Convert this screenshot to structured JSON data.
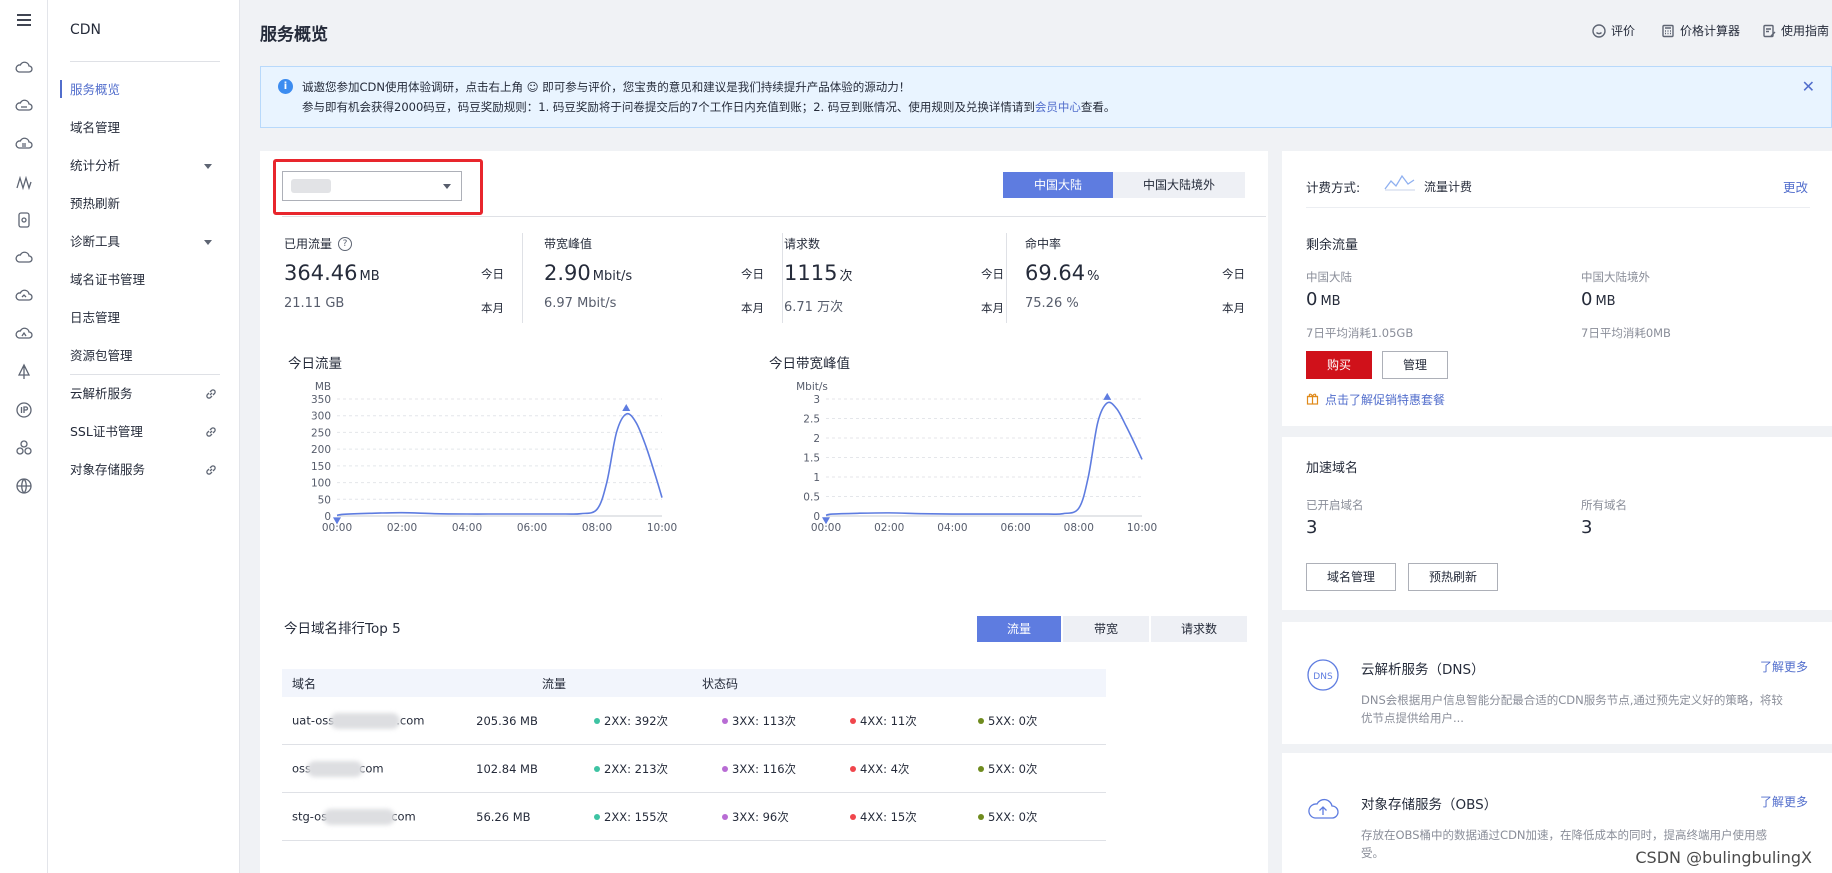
{
  "nav": {
    "title": "CDN",
    "items": [
      {
        "label": "服务概览"
      },
      {
        "label": "域名管理"
      },
      {
        "label": "统计分析"
      },
      {
        "label": "预热刷新"
      },
      {
        "label": "诊断工具"
      },
      {
        "label": "域名证书管理"
      },
      {
        "label": "日志管理"
      },
      {
        "label": "资源包管理"
      },
      {
        "label": "云解析服务"
      },
      {
        "label": "SSL证书管理"
      },
      {
        "label": "对象存储服务"
      }
    ]
  },
  "header": {
    "title": "服务概览",
    "links": [
      "评价",
      "价格计算器",
      "使用指南"
    ]
  },
  "notice": {
    "line1": "诚邀您参加CDN使用体验调研，点击右上角 ☺ 即可参与评价，您宝贵的意见和建议是我们持续提升产品体验的源动力！",
    "line2_prefix": "参与即有机会获得2000码豆，码豆奖励规则：1. 码豆奖励将于问卷提交后的7个工作日内充值到账；2. 码豆到账情况、使用规则及兑换详情请到",
    "line2_link": "会员中心",
    "line2_suffix": "查看。"
  },
  "region_tabs": [
    "中国大陆",
    "中国大陆境外"
  ],
  "metrics": [
    {
      "title": "已用流量",
      "value": "364.46",
      "unit": "MB",
      "today": "今日",
      "month_value": "21.11 GB",
      "month": "本月"
    },
    {
      "title": "带宽峰值",
      "value": "2.90",
      "unit": "Mbit/s",
      "today": "今日",
      "month_value": "6.97 Mbit/s",
      "month": "本月"
    },
    {
      "title": "请求数",
      "value": "1115",
      "unit": "次",
      "today": "今日",
      "month_value": "6.71 万次",
      "month": "本月"
    },
    {
      "title": "命中率",
      "value": "69.64",
      "unit": "%",
      "today": "今日",
      "month_value": "75.26 %",
      "month": "本月"
    }
  ],
  "chart_data": [
    {
      "type": "line",
      "title": "今日流量",
      "ylabel": "MB",
      "yticks": [
        0,
        50,
        100,
        150,
        200,
        250,
        300,
        350
      ],
      "ylim": [
        0,
        350
      ],
      "xticks": [
        "00:00",
        "02:00",
        "04:00",
        "06:00",
        "08:00",
        "10:00"
      ],
      "xlim": [
        0,
        10
      ],
      "x": [
        0,
        0.2,
        1,
        2,
        3,
        4,
        5,
        6,
        7,
        7.5,
        8,
        8.3,
        8.6,
        8.9,
        9.2,
        9.5,
        9.8,
        10.0
      ],
      "y": [
        2,
        5,
        8,
        10,
        7,
        6,
        6,
        6,
        6,
        7,
        20,
        100,
        250,
        305,
        280,
        210,
        120,
        55
      ],
      "color": "#5e7ce0"
    },
    {
      "type": "line",
      "title": "今日带宽峰值",
      "ylabel": "Mbit/s",
      "yticks": [
        0,
        0.5,
        1,
        1.5,
        2,
        2.5,
        3
      ],
      "ylim": [
        0,
        3
      ],
      "xticks": [
        "00:00",
        "02:00",
        "04:00",
        "06:00",
        "08:00",
        "10:00"
      ],
      "xlim": [
        0,
        10
      ],
      "x": [
        0,
        0.2,
        1,
        2,
        3,
        4,
        5,
        6,
        7,
        7.5,
        8,
        8.3,
        8.6,
        8.9,
        9.2,
        9.5,
        9.8,
        10.0
      ],
      "y": [
        0.02,
        0.05,
        0.07,
        0.08,
        0.06,
        0.05,
        0.05,
        0.05,
        0.05,
        0.06,
        0.2,
        1.0,
        2.4,
        2.9,
        2.75,
        2.3,
        1.8,
        1.45
      ],
      "color": "#5e7ce0"
    }
  ],
  "top5": {
    "title": "今日域名排行Top 5",
    "tabs": [
      "流量",
      "带宽",
      "请求数"
    ],
    "headers": [
      "域名",
      "流量",
      "状态码"
    ],
    "rows": [
      {
        "domain_prefix": "uat-oss",
        "domain_suffix": ".com",
        "traffic": "205.36 MB",
        "s2": "2XX: 392次",
        "s3": "3XX: 113次",
        "s4": "4XX: 11次",
        "s5": "5XX: 0次"
      },
      {
        "domain_prefix": "oss",
        "domain_suffix": "com",
        "traffic": "102.84 MB",
        "s2": "2XX: 213次",
        "s3": "3XX: 116次",
        "s4": "4XX: 4次",
        "s5": "5XX: 0次"
      },
      {
        "domain_prefix": "stg-os",
        "domain_suffix": "com",
        "traffic": "56.26 MB",
        "s2": "2XX: 155次",
        "s3": "3XX: 96次",
        "s4": "4XX: 15次",
        "s5": "5XX: 0次"
      }
    ],
    "status_colors": {
      "s2": "#3ec3a3",
      "s3": "#b86cd4",
      "s4": "#f0464c",
      "s5": "#6f8b1e"
    }
  },
  "billing": {
    "label": "计费方式:",
    "mode": "流量计费",
    "change": "更改",
    "remain_title": "剩余流量",
    "cn_label": "中国大陆",
    "cn_value": "0",
    "cn_unit": "MB",
    "cn_avg": "7日平均消耗1.05GB",
    "os_label": "中国大陆境外",
    "os_value": "0",
    "os_unit": "MB",
    "os_avg": "7日平均消耗0MB",
    "buy": "购买",
    "manage": "管理",
    "promo": "点击了解促销特惠套餐"
  },
  "domains": {
    "title": "加速域名",
    "enabled_label": "已开启域名",
    "enabled_value": "3",
    "all_label": "所有域名",
    "all_value": "3",
    "btn_manage": "域名管理",
    "btn_refresh": "预热刷新"
  },
  "dns": {
    "title": "云解析服务（DNS）",
    "more": "了解更多",
    "desc1": "DNS会根据用户信息智能分配最合适的CDN服务节点,通过预先定义好的策略，将较",
    "desc2": "优节点提供给用户..."
  },
  "obs": {
    "title": "对象存储服务（OBS）",
    "more": "了解更多",
    "desc1": "存放在OBS桶中的数据通过CDN加速，在降低成本的同时，提高终端用户使用感",
    "desc2": "受。"
  },
  "watermark": "CSDN @bulingbulingX"
}
